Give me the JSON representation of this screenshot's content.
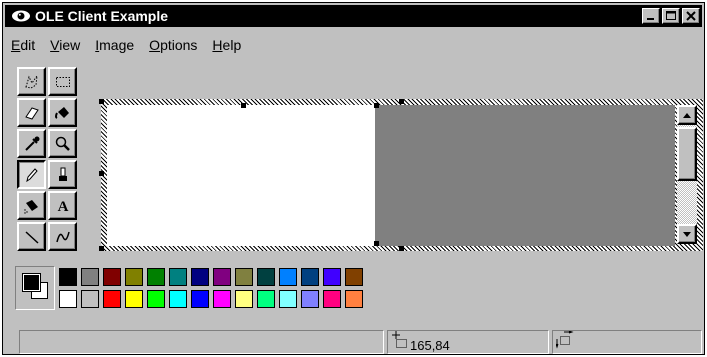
{
  "window": {
    "title": "OLE Client Example",
    "app_icon": "eye-icon",
    "controls": [
      "minimize-icon",
      "maximize-icon",
      "close-icon"
    ]
  },
  "menu": {
    "items": [
      {
        "label": "Edit",
        "hotkey": "E"
      },
      {
        "label": "View",
        "hotkey": "V"
      },
      {
        "label": "Image",
        "hotkey": "I"
      },
      {
        "label": "Options",
        "hotkey": "O"
      },
      {
        "label": "Help",
        "hotkey": "H"
      }
    ]
  },
  "tools": [
    {
      "name": "free-form-select-icon"
    },
    {
      "name": "rect-select-icon"
    },
    {
      "name": "eraser-icon"
    },
    {
      "name": "fill-bucket-icon"
    },
    {
      "name": "color-picker-icon"
    },
    {
      "name": "magnifier-icon"
    },
    {
      "name": "pencil-icon",
      "selected": true
    },
    {
      "name": "brush-icon"
    },
    {
      "name": "airbrush-icon"
    },
    {
      "name": "text-icon"
    },
    {
      "name": "line-icon"
    },
    {
      "name": "curve-icon"
    }
  ],
  "palette": {
    "foreground": "#000000",
    "background": "#ffffff",
    "top_row": [
      "#000000",
      "#808080",
      "#800000",
      "#808000",
      "#008000",
      "#008080",
      "#000080",
      "#800080",
      "#808040",
      "#004040",
      "#0080ff",
      "#004080",
      "#4000ff",
      "#804000"
    ],
    "bottom_row": [
      "#ffffff",
      "#c0c0c0",
      "#ff0000",
      "#ffff00",
      "#00ff00",
      "#00ffff",
      "#0000ff",
      "#ff00ff",
      "#ffff80",
      "#00ff80",
      "#80ffff",
      "#8080ff",
      "#ff0080",
      "#ff8040"
    ]
  },
  "status": {
    "message": "",
    "coords": "165,84",
    "size": ""
  }
}
